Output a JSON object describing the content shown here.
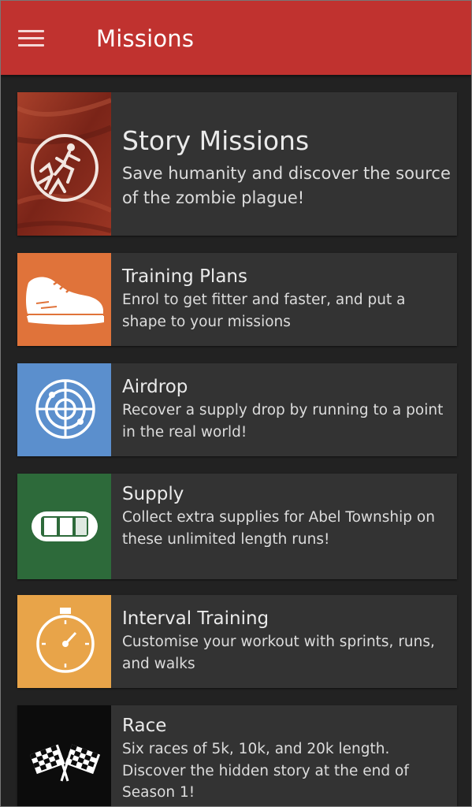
{
  "appbar": {
    "title": "Missions",
    "menu_icon": "hamburger-menu-icon",
    "color": "#c0322f"
  },
  "missions": [
    {
      "title": "Story Missions",
      "description": "Save humanity and discover the source of the zombie plague!",
      "icon": "running-from-zombies-icon",
      "color": "#8a2a1c"
    },
    {
      "title": "Training Plans",
      "description": "Enrol to get fitter and faster, and put a shape to your missions",
      "icon": "running-shoe-icon",
      "color": "#e0733a"
    },
    {
      "title": "Airdrop",
      "description": "Recover a supply drop by running to a point in the real world!",
      "icon": "radar-icon",
      "color": "#5b8fcd"
    },
    {
      "title": "Supply",
      "description": "Collect extra supplies for Abel Township on these unlimited length runs!",
      "icon": "running-track-icon",
      "color": "#2d6a3a"
    },
    {
      "title": "Interval Training",
      "description": "Customise your workout with sprints, runs, and walks",
      "icon": "stopwatch-icon",
      "color": "#e8a449"
    },
    {
      "title": "Race",
      "description": "Six races of 5k, 10k, and 20k length. Discover the hidden story at the end of Season 1!",
      "icon": "checkered-flags-icon",
      "color": "#0c0c0c"
    }
  ]
}
